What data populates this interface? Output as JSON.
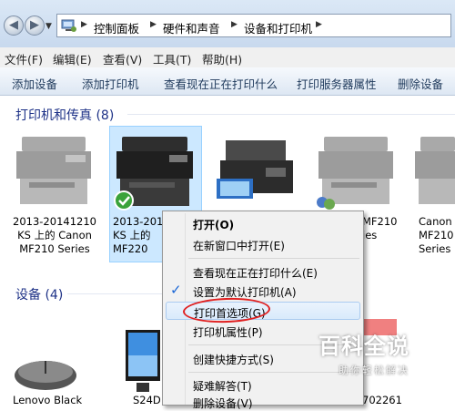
{
  "address_bar": {
    "crumbs": [
      "控制面板",
      "硬件和声音",
      "设备和打印机"
    ]
  },
  "menu": {
    "items": [
      "文件(F)",
      "编辑(E)",
      "查看(V)",
      "工具(T)",
      "帮助(H)"
    ]
  },
  "toolbar": {
    "items": [
      "添加设备",
      "添加打印机",
      "查看现在正在打印什么",
      "打印服务器属性",
      "删除设备"
    ]
  },
  "printers_group": {
    "title": "打印机和传真 (8)"
  },
  "printers": [
    {
      "label": "2013-20141210\nKS 上的 Canon\nMF210 Series"
    },
    {
      "label": "2013-201\nKS 上的\nMF220"
    },
    {
      "label": ""
    },
    {
      "label": "MF210\nies"
    },
    {
      "label": "Canon\nMF210\nSeries"
    }
  ],
  "devices_group": {
    "title": "设备 (4)"
  },
  "devices": [
    {
      "label": "Lenovo Black"
    },
    {
      "label": "S24D"
    },
    {
      "label": "702261"
    }
  ],
  "context_menu": {
    "items": [
      {
        "label": "打开(O)",
        "bold": true
      },
      {
        "label": "在新窗口中打开(E)"
      },
      {
        "label": "查看现在正在打印什么(E)"
      },
      {
        "label": "设置为默认打印机(A)",
        "checked": true
      },
      {
        "label": "打印首选项(G)",
        "highlighted": true
      },
      {
        "label": "打印机属性(P)"
      },
      {
        "label": "创建快捷方式(S)"
      },
      {
        "label": "疑难解答(T)"
      },
      {
        "label": "删除设备(V)"
      }
    ]
  },
  "watermark": {
    "title": "百科全说",
    "subtitle": "助你轻松解决"
  },
  "colors": {
    "group_header": "#1e3287",
    "selection": "#cce8ff",
    "annotation": "#e02020"
  }
}
